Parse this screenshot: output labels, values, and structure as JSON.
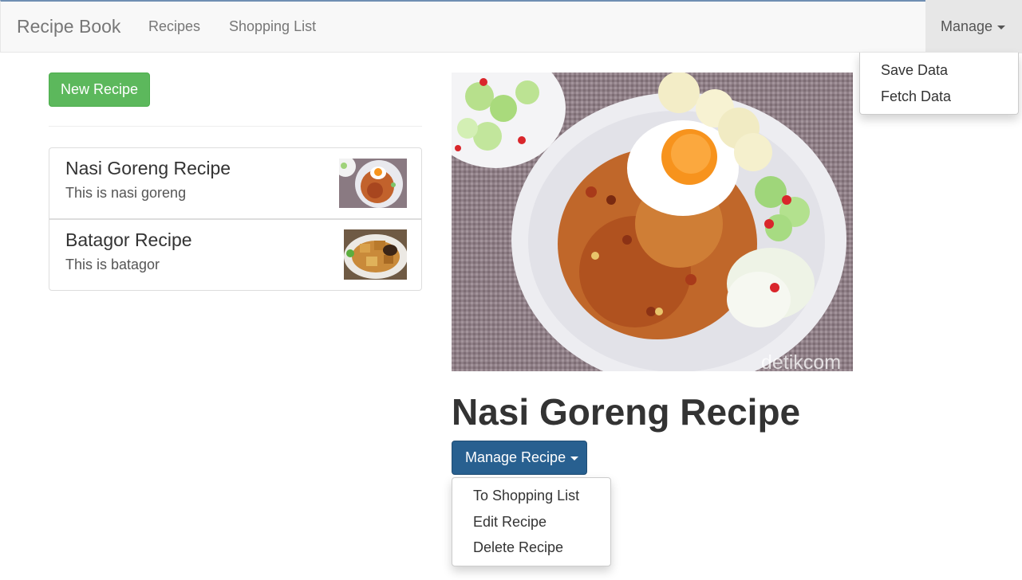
{
  "navbar": {
    "brand": "Recipe Book",
    "links": [
      "Recipes",
      "Shopping List"
    ],
    "manage_label": "Manage",
    "manage_menu": [
      "Save Data",
      "Fetch Data"
    ]
  },
  "sidebar": {
    "new_button": "New Recipe",
    "recipes": [
      {
        "name": "Nasi Goreng Recipe",
        "description": "This is nasi goreng",
        "image": "nasi-goreng-thumbnail"
      },
      {
        "name": "Batagor Recipe",
        "description": "This is batagor",
        "image": "batagor-thumbnail"
      }
    ]
  },
  "detail": {
    "image": "nasi-goreng-photo",
    "watermark": "detikcom",
    "title": "Nasi Goreng Recipe",
    "manage_button": "Manage Recipe",
    "manage_menu": [
      "To Shopping List",
      "Edit Recipe",
      "Delete Recipe"
    ]
  },
  "colors": {
    "success": "#5cb85c",
    "primary": "#286090",
    "navbar_bg": "#f8f8f8"
  }
}
